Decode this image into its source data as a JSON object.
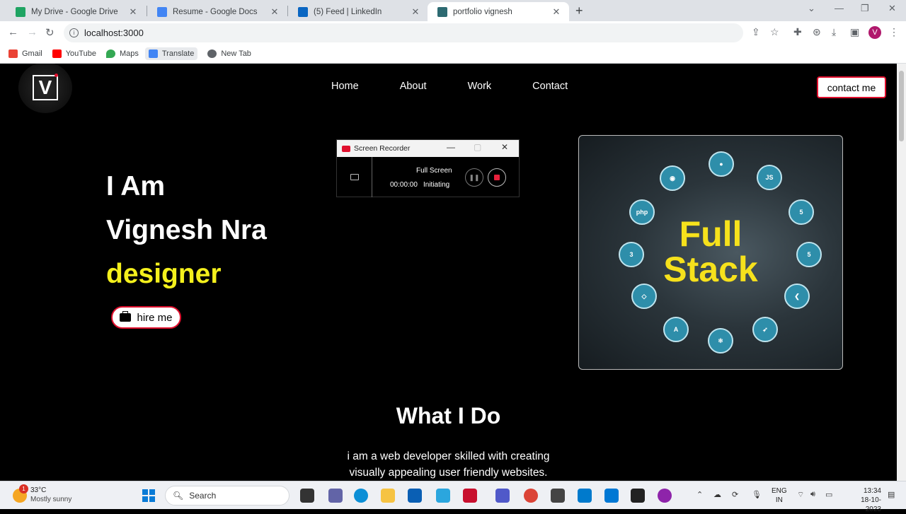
{
  "browser": {
    "tabs": [
      {
        "title": "My Drive - Google Drive",
        "icon_color": "#1fa463"
      },
      {
        "title": "Resume - Google Docs",
        "icon_color": "#4285f4"
      },
      {
        "title": "(5) Feed | LinkedIn",
        "icon_color": "#0a66c2"
      },
      {
        "title": "portfolio vignesh",
        "icon_color": "#2d6a72"
      }
    ],
    "new_tab": "+",
    "url": "localhost:3000",
    "profile_initial": "V",
    "bookmarks": [
      {
        "label": "Gmail",
        "icon_color": "#ea4335"
      },
      {
        "label": "YouTube",
        "icon_color": "#ff0000"
      },
      {
        "label": "Maps",
        "icon_color": "#34a853"
      },
      {
        "label": "Translate",
        "icon_color": "#4285f4"
      },
      {
        "label": "New Tab",
        "icon_color": "#5f6368"
      }
    ]
  },
  "site": {
    "logo_letter": "V",
    "nav": [
      "Home",
      "About",
      "Work",
      "Contact"
    ],
    "contact_label": "contact me",
    "hero": {
      "line1": "I Am",
      "line2": "Vignesh Nra",
      "role": "designer",
      "hire_label": "hire me"
    },
    "image": {
      "text1": "Full",
      "text2": "Stack",
      "tech_icons": [
        "android-icon",
        "apple-icon",
        "nodejs-icon",
        "php-icon",
        "html5-icon",
        "css3-icon",
        "html5-icon",
        "laravel-icon",
        "flutter-icon",
        "angular-icon",
        "react-icon",
        "swift-icon"
      ],
      "tech_labels": {
        "php": "php",
        "js": "JS",
        "css": "3",
        "html": "5",
        "angular": "A"
      }
    },
    "section": {
      "title": "What I Do",
      "text_line1": "i am a web developer skilled with creating",
      "text_line2": "visually appealing user friendly websites."
    }
  },
  "recorder": {
    "title": "Screen Recorder",
    "mode": "Full Screen",
    "time": "00:00:00",
    "status": "Initiating"
  },
  "taskbar": {
    "badge": "1",
    "temp": "33°C",
    "weather": "Mostly sunny",
    "search_label": "Search",
    "lang1": "ENG",
    "lang2": "IN",
    "time": "13:34",
    "date": "18-10-2023"
  }
}
